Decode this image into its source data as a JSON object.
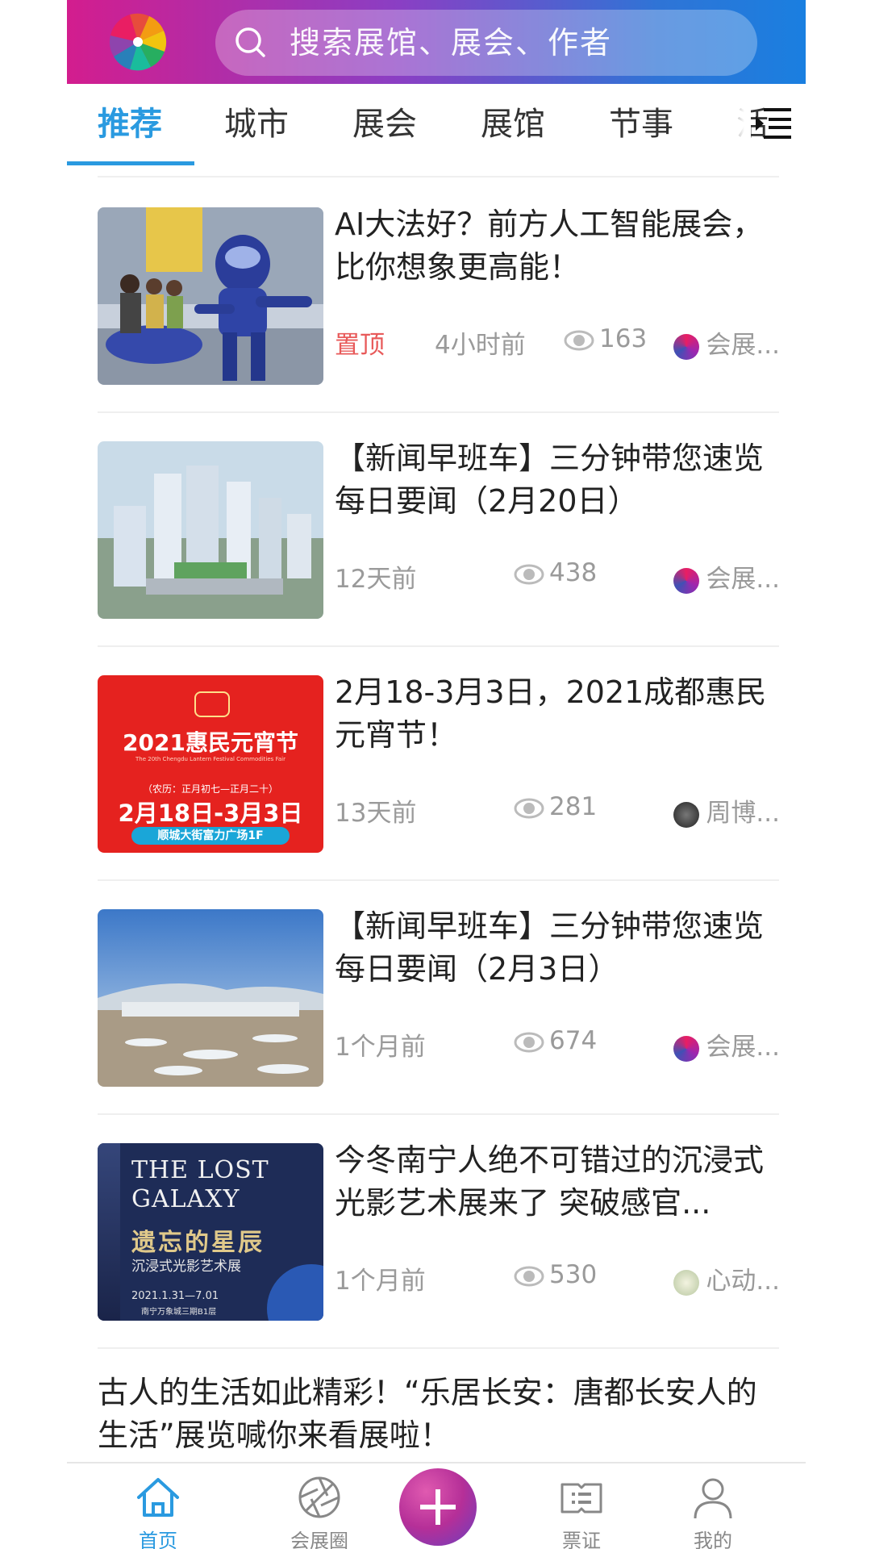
{
  "header": {
    "search_placeholder": "搜索展馆、展会、作者"
  },
  "tabs": [
    {
      "label": "推荐",
      "active": true
    },
    {
      "label": "城市"
    },
    {
      "label": "展会"
    },
    {
      "label": "展馆"
    },
    {
      "label": "节事"
    },
    {
      "label": "活"
    }
  ],
  "articles": [
    {
      "title": "AI大法好？前方人工智能展会，比你想象更高能！",
      "pinned_label": "置顶",
      "time": "4小时前",
      "views": "163",
      "author": "会展..."
    },
    {
      "title": "【新闻早班车】三分钟带您速览每日要闻（2月20日）",
      "time": "12天前",
      "views": "438",
      "author": "会展..."
    },
    {
      "title": "2月18-3月3日，2021成都惠民元宵节！",
      "time": "13天前",
      "views": "281",
      "author": "周博..."
    },
    {
      "title": "【新闻早班车】三分钟带您速览每日要闻（2月3日）",
      "time": "1个月前",
      "views": "674",
      "author": "会展..."
    },
    {
      "title": "今冬南宁人绝不可错过的沉浸式光影艺术展来了 突破感官...",
      "time": "1个月前",
      "views": "530",
      "author": "心动..."
    }
  ],
  "poster3": {
    "line1": "2021惠民元宵节",
    "line2": "The 20th Chengdu Lantern Festival Commodities Fair",
    "line3": "（农历：正月初七—正月二十）",
    "line4": "2月18日-3月3日",
    "line5": "顺城大街富力广场1F"
  },
  "poster5": {
    "line1": "THE LOST",
    "line2": "GALAXY",
    "line3": "遗忘的星辰",
    "line4": "沉浸式光影艺术展",
    "line5": "2021.1.31—7.01",
    "line6": "南宁万象城三期B1层"
  },
  "last_article_title": "古人的生活如此精彩！“乐居长安：唐都长安人的生活”展览喊你来看展啦！",
  "bottom_nav": [
    {
      "label": "首页",
      "active": true
    },
    {
      "label": "会展圈"
    },
    {
      "label": "票证"
    },
    {
      "label": "我的"
    }
  ],
  "colors": {
    "accent": "#2a9ae0",
    "pin": "#e85a5a"
  }
}
